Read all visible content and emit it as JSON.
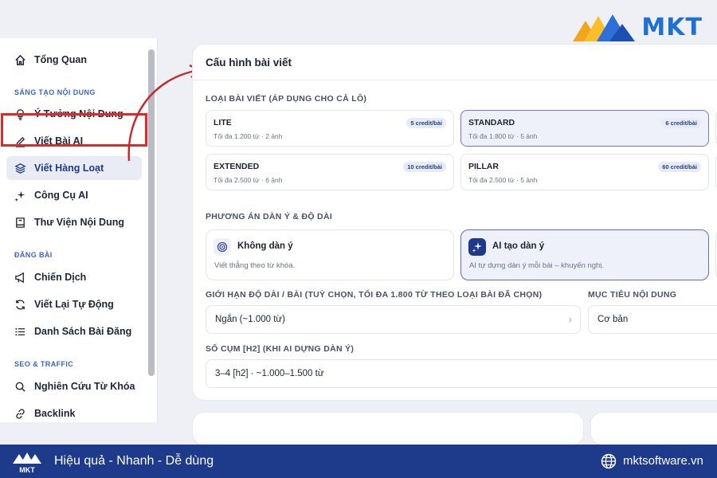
{
  "brand": {
    "name": "MKT"
  },
  "sidebar": {
    "overview": "Tổng Quan",
    "section_create": "SÁNG TẠO NỘI DUNG",
    "items_create": [
      "Ý Tưởng Nội Dung",
      "Viết Bài AI",
      "Viết Hàng Loạt",
      "Công Cụ AI",
      "Thư Viện Nội Dung"
    ],
    "section_post": "ĐĂNG BÀI",
    "items_post": [
      "Chiến Dịch",
      "Viết Lại Tự Động",
      "Danh Sách Bài Đăng"
    ],
    "section_seo": "SEO & TRAFFIC",
    "items_seo": [
      "Nghiên Cứu Từ Khóa",
      "Backlink"
    ],
    "active": "Viết Hàng Loạt"
  },
  "config": {
    "title": "Cấu hình bài viết",
    "type_label": "LOẠI BÀI VIẾT (ÁP DỤNG CHO CẢ LÔ)",
    "types": [
      {
        "name": "LITE",
        "desc": "Tối đa 1.200 từ · 2 ảnh",
        "badge": "5 credit/bài",
        "selected": false
      },
      {
        "name": "STANDARD",
        "desc": "Tối đa 1.800 từ · 5 ảnh",
        "badge": "6 credit/bài",
        "selected": true
      },
      {
        "name": "EXTENDED",
        "desc": "Tối đa 2.500 từ · 6 ảnh",
        "badge": "10 credit/bài",
        "selected": false
      },
      {
        "name": "PILLAR",
        "desc": "Tối đa 2.500 từ · 5 ảnh",
        "badge": "60 credit/bài",
        "selected": false
      }
    ],
    "outline_label": "PHƯƠNG ÁN DÀN Ý & ĐỘ DÀI",
    "outlines": [
      {
        "name": "Không dàn ý",
        "desc": "Viết thẳng theo từ khóa.",
        "selected": false
      },
      {
        "name": "AI tạo dàn ý",
        "desc": "AI tự dựng dàn ý mỗi bài – khuyến nghị.",
        "selected": true
      }
    ],
    "length_label": "GIỚI HẠN ĐỘ DÀI / BÀI (TUỲ CHỌN, TỐI ĐA 1.800 TỪ THEO LOẠI BÀI ĐÃ CHỌN)",
    "length_value": "Ngắn (~1.000 từ)",
    "goal_label": "MỤC TIÊU NỘI DUNG",
    "goal_value": "Cơ bản",
    "cluster_label": "SỐ CỤM [H2] (KHI AI DỰNG DÀN Ý)",
    "cluster_value": "3–4 [h2] · ~1.000–1.500 từ"
  },
  "footer": {
    "tagline": "Hiệu quả - Nhanh - Dễ dùng",
    "url": "mktsoftware.vn"
  },
  "colors": {
    "accent": "#1e3a8a",
    "highlight_frame": "#e02a2a",
    "selected_border": "#6c7bc2"
  }
}
